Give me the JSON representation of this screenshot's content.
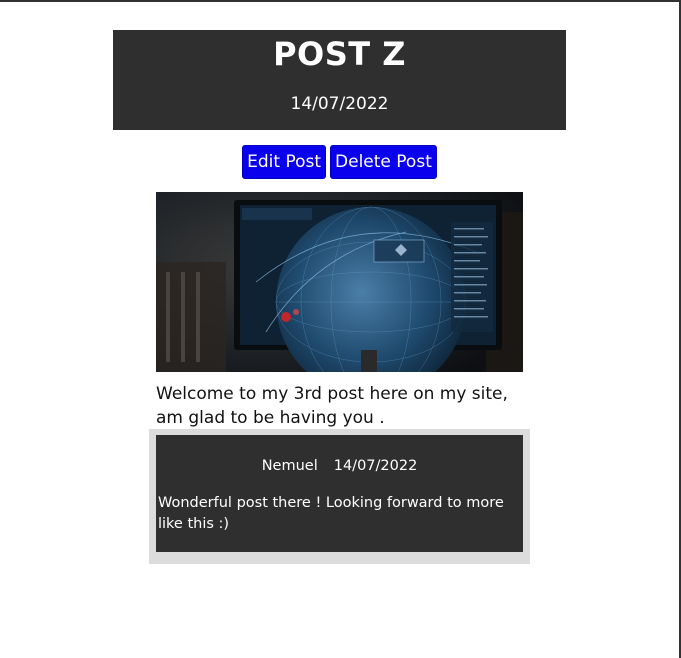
{
  "post": {
    "title": "POST Z",
    "date": "14/07/2022",
    "body": "Welcome to my 3rd post here on my site, am glad to be having you ."
  },
  "actions": {
    "edit_label": "Edit Post",
    "delete_label": "Delete Post"
  },
  "colors": {
    "header_bg": "#2f2f2f",
    "button_bg": "#0b00ee",
    "comments_bg": "#dcdcdc"
  },
  "comments": [
    {
      "author": "Nemuel",
      "date": "14/07/2022",
      "text": "Wonderful post there ! Looking forward to more like this :)"
    }
  ]
}
